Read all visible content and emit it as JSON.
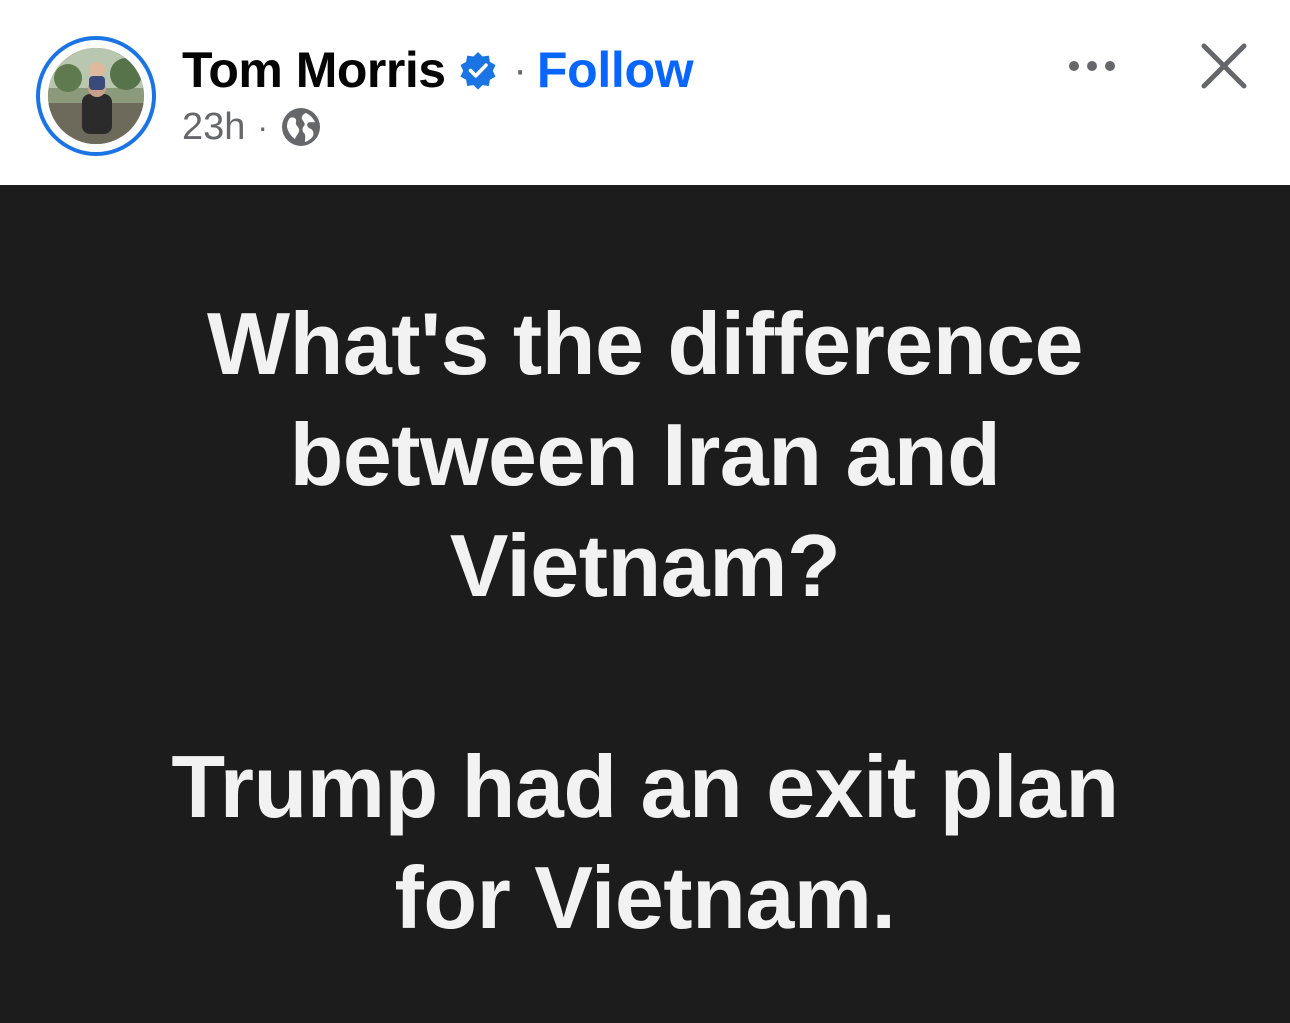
{
  "post": {
    "author": {
      "name": "Tom Morris",
      "verified": true
    },
    "follow_label": "Follow",
    "separator": "·",
    "timestamp": "23h",
    "audience_icon": "globe-icon",
    "text_lines": [
      "What's the difference",
      "between Iran and",
      "Vietnam?",
      "Trump had an exit plan",
      "for Vietnam."
    ],
    "background_color": "#1c1c1c",
    "text_color": "#f2f2f2"
  },
  "controls": {
    "more_icon": "more-horizontal-icon",
    "close_icon": "close-icon"
  },
  "colors": {
    "accent": "#0866ff",
    "ring": "#1b74e4",
    "secondary_text": "#65676b"
  }
}
